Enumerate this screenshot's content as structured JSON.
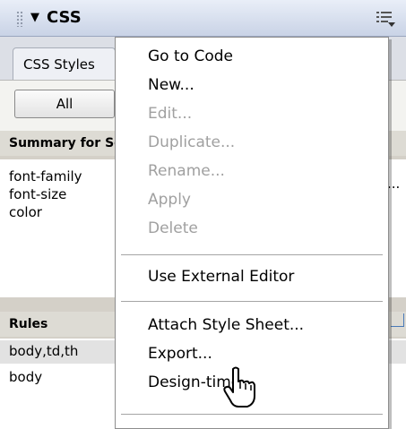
{
  "panel": {
    "title": "CSS",
    "collapse_glyph": "▼",
    "options_icon": "panel-options-icon"
  },
  "tabs": [
    {
      "label": "CSS Styles"
    }
  ],
  "toggle": {
    "label": "All"
  },
  "summary": {
    "header": "Summary for Selection",
    "properties": [
      "font-family",
      "font-size",
      "color"
    ],
    "value_ellipsis": "..."
  },
  "rules": {
    "header": "Rules",
    "items": [
      "body,td,th",
      "body"
    ]
  },
  "context_menu": {
    "items": [
      {
        "label": "Go to Code",
        "enabled": true
      },
      {
        "label": "New...",
        "enabled": true
      },
      {
        "label": "Edit...",
        "enabled": false
      },
      {
        "label": "Duplicate...",
        "enabled": false
      },
      {
        "label": "Rename...",
        "enabled": false
      },
      {
        "label": "Apply",
        "enabled": false
      },
      {
        "label": "Delete",
        "enabled": false
      },
      {
        "label": "Use External Editor",
        "enabled": true
      },
      {
        "label": "Attach Style Sheet...",
        "enabled": true
      },
      {
        "label": "Export...",
        "enabled": true
      },
      {
        "label": "Design-time...",
        "enabled": true
      }
    ]
  },
  "cursor": "hand-pointer-icon"
}
